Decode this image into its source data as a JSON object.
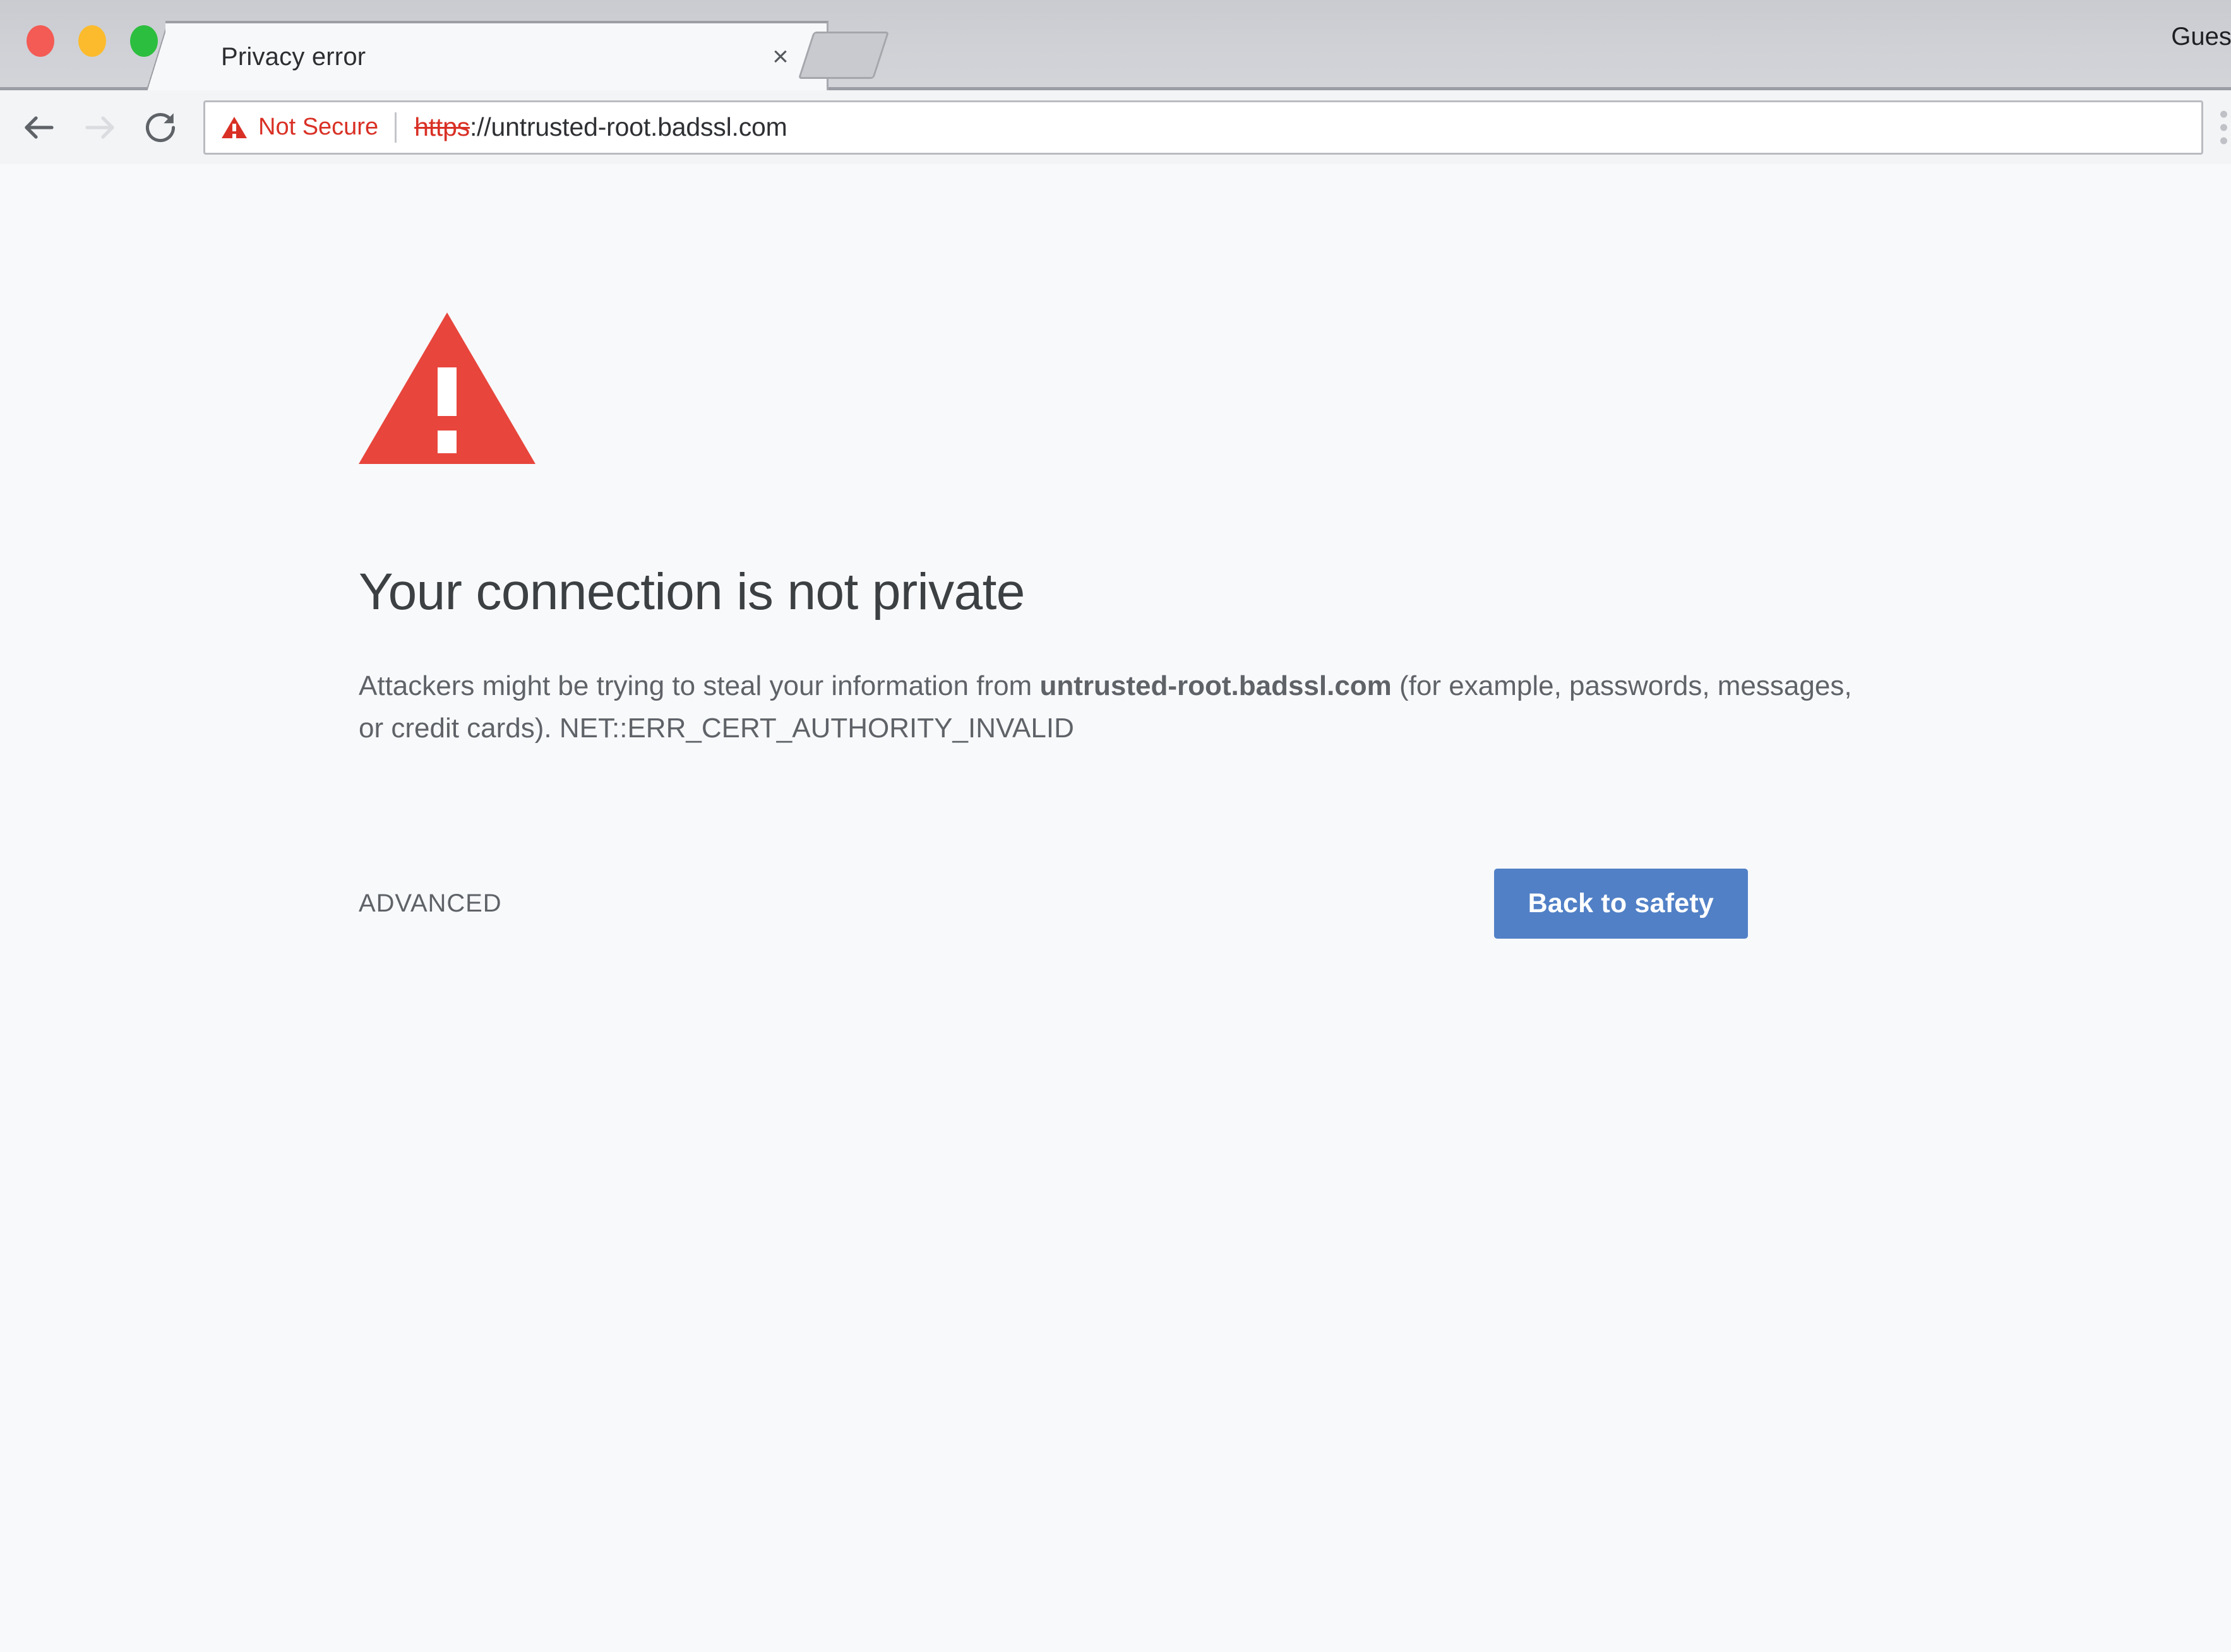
{
  "window": {
    "traffic_lights": [
      {
        "name": "close",
        "color": "#f35b54"
      },
      {
        "name": "minimize",
        "color": "#fcbb2d"
      },
      {
        "name": "zoom",
        "color": "#2cbe3e"
      }
    ],
    "profile_label": "Guest"
  },
  "tabs": [
    {
      "title": "Privacy error",
      "close_glyph": "×",
      "active": true
    }
  ],
  "toolbar": {
    "back_icon": "back-arrow-icon",
    "forward_icon": "forward-arrow-icon",
    "reload_icon": "reload-icon",
    "menu_icon": "three-dot-menu-icon",
    "omnibox": {
      "security_label": "Not Secure",
      "security_icon": "warning-triangle-icon",
      "security_color": "#d93025",
      "url_scheme": "https",
      "url_rest": "://untrusted-root.badssl.com",
      "full_url": "https://untrusted-root.badssl.com"
    }
  },
  "interstitial": {
    "icon": "warning-triangle-icon",
    "icon_color": "#e8453c",
    "headline": "Your connection is not private",
    "body_prefix": "Attackers might be trying to steal your information from ",
    "body_domain": "untrusted-root.badssl.com",
    "body_suffix": " (for example, passwords, messages, or credit cards). ",
    "error_code": "NET::ERR_CERT_AUTHORITY_INVALID",
    "advanced_label": "ADVANCED",
    "primary_button_label": "Back to safety",
    "primary_button_color": "#5180c6"
  }
}
